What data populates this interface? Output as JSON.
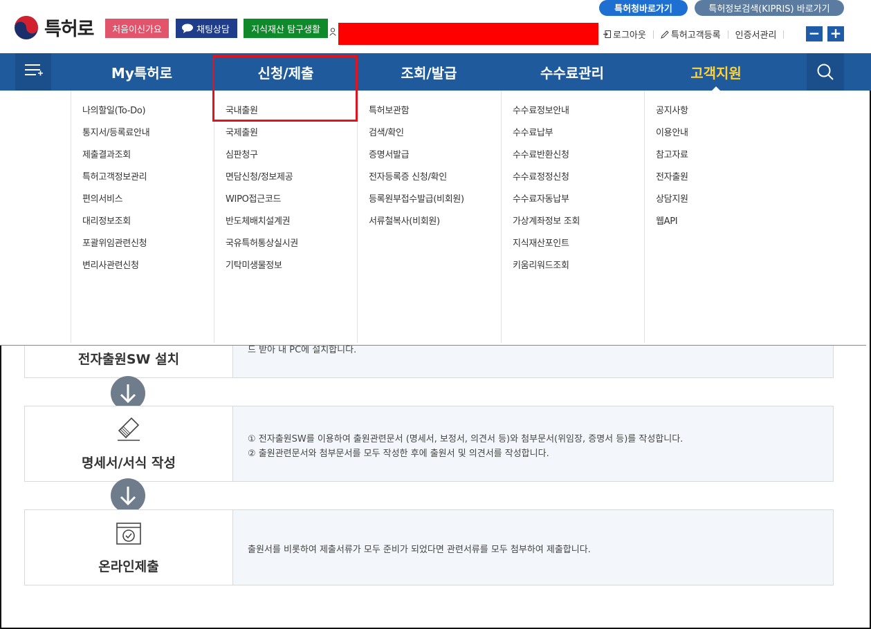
{
  "header": {
    "logo_text": "특허로",
    "chip_first_visit": "처음이신가요",
    "chip_chat": "채팅상담",
    "chip_ip": "지식재산 탐구생활",
    "pill_kipo": "특허청바로가기",
    "pill_kipris": "특허정보검색(KIPRIS) 바로가기",
    "logout": "로그아웃",
    "customer_register": "특허고객등록",
    "cert_manage": "인증서관리",
    "zoom_out": "−",
    "zoom_in": "+"
  },
  "nav": {
    "items": [
      {
        "label": "My특허로"
      },
      {
        "label": "신청/제출"
      },
      {
        "label": "조회/발급"
      },
      {
        "label": "수수료관리"
      },
      {
        "label": "고객지원"
      }
    ]
  },
  "dropdown": {
    "columns": [
      {
        "items": [
          "나의할일(To-Do)",
          "통지서/등록료안내",
          "제출결과조회",
          "특허고객정보관리",
          "편의서비스",
          "대리정보조회",
          "포괄위임관련신청",
          "변리사관련신청"
        ]
      },
      {
        "items": [
          "국내출원",
          "국제출원",
          "심판청구",
          "면담신청/정보제공",
          "WIPO접근코드",
          "반도체배치설계권",
          "국유특허통상실시권",
          "기탁미생물정보"
        ]
      },
      {
        "items": [
          "특허보관함",
          "검색/확인",
          "증명서발급",
          "전자등록증 신청/확인",
          "등록원부접수발급(비회원)",
          "서류철복사(비회원)"
        ]
      },
      {
        "items": [
          "수수료정보안내",
          "수수료납부",
          "수수료반환신청",
          "수수료정정신청",
          "수수료자동납부",
          "가상계좌정보 조회",
          "지식재산포인트",
          "키움리워드조회"
        ]
      },
      {
        "items": [
          "공지사항",
          "이용안내",
          "참고자료",
          "전자출원",
          "상담지원",
          "웹API"
        ]
      }
    ]
  },
  "steps": [
    {
      "title": "전자출원SW 설치",
      "desc_lines": [
        "드 받아 내 PC에 설치합니다."
      ]
    },
    {
      "title": "명세서/서식 작성",
      "desc_lines": [
        "① 전자출원SW를 이용하여 출원관련문서 (명세서, 보정서, 의견서 등)와 첨부문서(위임장, 증명서 등)를 작성합니다.",
        "② 출원관련문서와 첨부문서를 모두 작성한 후에 출원서 및 의견서를 작성합니다."
      ]
    },
    {
      "title": "온라인제출",
      "desc_lines": [
        "출원서를 비롯하여 제출서류가 모두 준비가 되었다면 관련서류를 모두 첨부하여 제출합니다."
      ]
    }
  ],
  "colors": {
    "nav_bg": "#1e5a9c",
    "nav_active": "#ffd23a",
    "highlight": "#e0141e",
    "redaction": "#ff0000"
  }
}
